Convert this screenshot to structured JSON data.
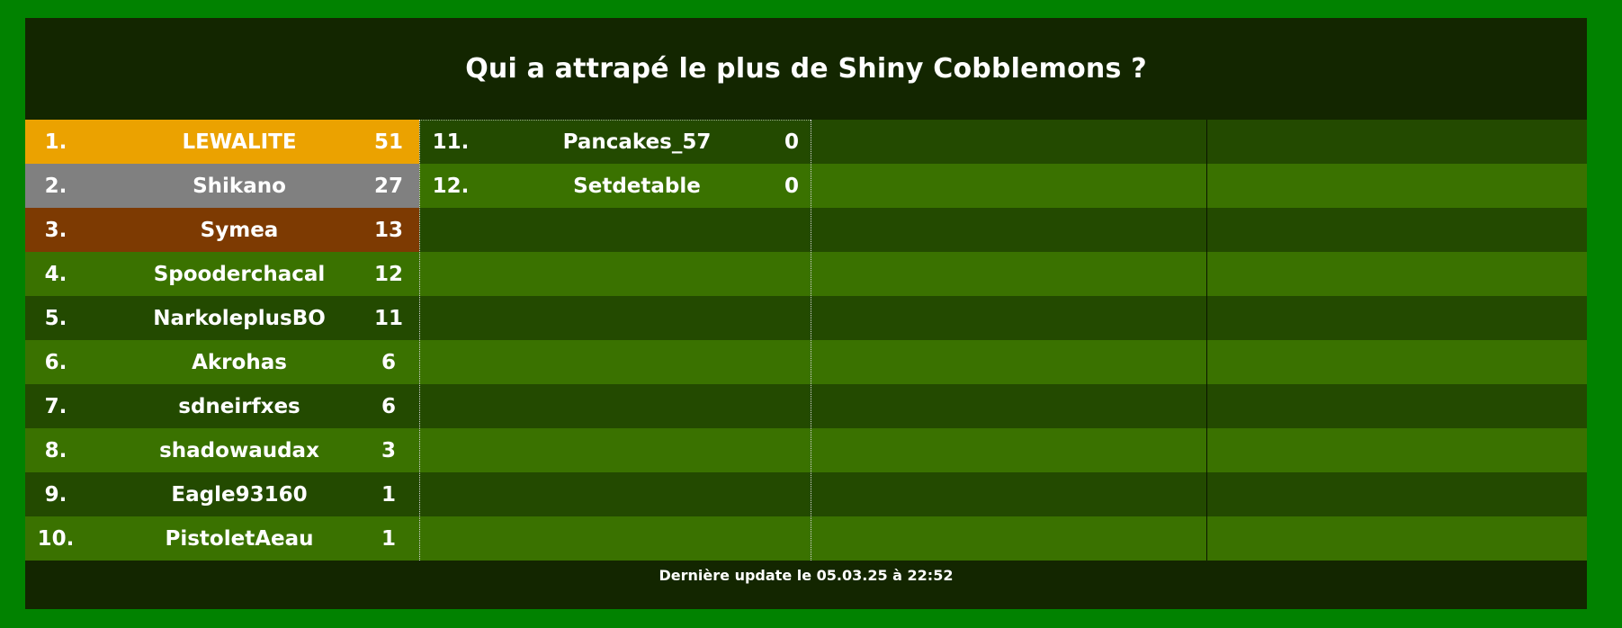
{
  "title": "Qui a attrapé le plus de Shiny Cobblemons ?",
  "colors": {
    "frame": "#018200",
    "background": "#132600",
    "row_dark": "#234a00",
    "row_light": "#3a7200",
    "gold": "#eba200",
    "silver": "#808080",
    "bronze": "#7d3a02",
    "text": "#ffffff"
  },
  "leaderboard": {
    "column_1": [
      {
        "rank": "1.",
        "name": "LEWALITE",
        "score": "51",
        "highlight": "gold"
      },
      {
        "rank": "2.",
        "name": "Shikano",
        "score": "27",
        "highlight": "silver"
      },
      {
        "rank": "3.",
        "name": "Symea",
        "score": "13",
        "highlight": "bronze"
      },
      {
        "rank": "4.",
        "name": "Spooderchacal",
        "score": "12"
      },
      {
        "rank": "5.",
        "name": "NarkoleplusBO",
        "score": "11"
      },
      {
        "rank": "6.",
        "name": "Akrohas",
        "score": "6"
      },
      {
        "rank": "7.",
        "name": "sdneirfxes",
        "score": "6"
      },
      {
        "rank": "8.",
        "name": "shadowaudax",
        "score": "3"
      },
      {
        "rank": "9.",
        "name": "Eagle93160",
        "score": "1"
      },
      {
        "rank": "10.",
        "name": "PistoletAeau",
        "score": "1"
      }
    ],
    "column_2": [
      {
        "rank": "11.",
        "name": "Pancakes_57",
        "score": "0"
      },
      {
        "rank": "12.",
        "name": "Setdetable",
        "score": "0"
      }
    ]
  },
  "footer": "Dernière update le 05.03.25 à 22:52"
}
